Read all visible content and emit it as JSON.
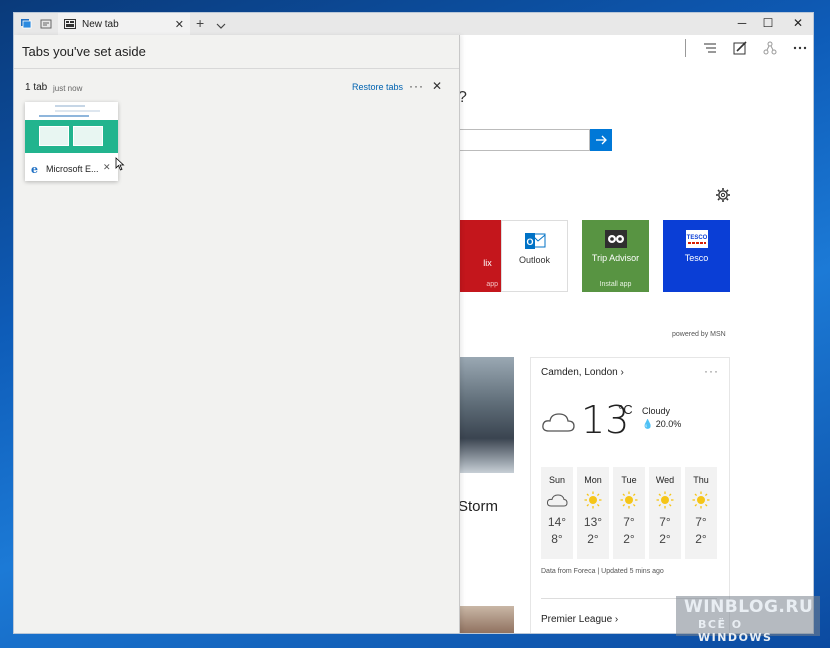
{
  "window": {
    "tab_title": "New tab",
    "minimize_glyph": "─",
    "maximize_glyph": "☐",
    "close_glyph": "✕",
    "newtab_glyph": "+",
    "tab_close_glyph": "✕"
  },
  "page": {
    "question_mark": "?",
    "tiles": [
      {
        "label": "lix",
        "sub": "app",
        "color": "#c4161c"
      },
      {
        "label": "Outlook",
        "sub": "",
        "color": "#ffffff"
      },
      {
        "label": "Trip Advisor",
        "sub": "Install app",
        "color": "#589442"
      },
      {
        "label": "Tesco",
        "sub": "",
        "color": "#0a3ed6"
      }
    ],
    "powered_by": "powered by MSN",
    "news_title": "Storm",
    "weather": {
      "location": "Camden, London",
      "more": "···",
      "temperature": "13",
      "unit": "°C",
      "condition": "Cloudy",
      "precip": "20.0%",
      "days": [
        {
          "name": "Sun",
          "hi": "14°",
          "lo": "8°",
          "icon": "cloud-icon"
        },
        {
          "name": "Mon",
          "hi": "13°",
          "lo": "2°",
          "icon": "sun-icon"
        },
        {
          "name": "Tue",
          "hi": "7°",
          "lo": "2°",
          "icon": "sun-icon"
        },
        {
          "name": "Wed",
          "hi": "7°",
          "lo": "2°",
          "icon": "sun-icon"
        },
        {
          "name": "Thu",
          "hi": "7°",
          "lo": "2°",
          "icon": "sun-icon"
        }
      ],
      "source": "Data from Foreca | Updated 5 mins ago"
    },
    "league": "Premier League"
  },
  "panel": {
    "title": "Tabs you've set aside",
    "group": {
      "count": "1 tab",
      "time": "just now",
      "restore": "Restore tabs",
      "more": "···",
      "close": "✕"
    },
    "thumb": {
      "label": "Microsoft E...",
      "close": "✕",
      "icon_glyph": "e"
    }
  },
  "watermark": {
    "main": "WINBLOG.RU",
    "sub": "ВСЁ О WINDOWS"
  }
}
